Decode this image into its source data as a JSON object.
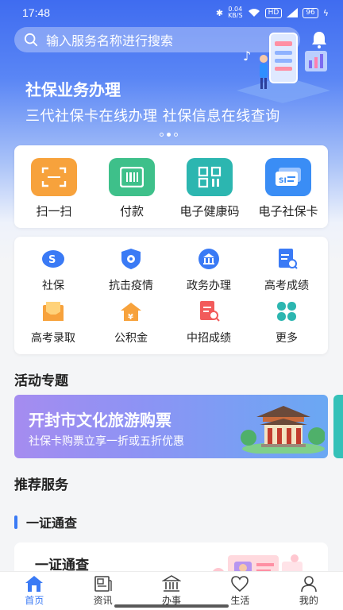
{
  "status_bar": {
    "time": "17:48",
    "net_speed_value": "0.04",
    "net_speed_unit": "KB/S",
    "hd_label": "HD",
    "battery": "96"
  },
  "search": {
    "placeholder": "输入服务名称进行搜索",
    "icon": "search-icon"
  },
  "banner": {
    "title": "社保业务办理",
    "subtitle": "三代社保卡在线办理  社保信息在线查询",
    "page_count": 3,
    "active_page": 2
  },
  "quick_actions": [
    {
      "label": "扫一扫",
      "icon": "scan-icon",
      "color": "#f7a23c"
    },
    {
      "label": "付款",
      "icon": "barcode-icon",
      "color": "#3ec08a"
    },
    {
      "label": "电子健康码",
      "icon": "qrcode-icon",
      "color": "#2cb6b0"
    },
    {
      "label": "电子社保卡",
      "icon": "social-security-card-icon",
      "color": "#3a8df5"
    }
  ],
  "services": [
    {
      "label": "社保",
      "icon": "social-security-icon"
    },
    {
      "label": "抗击疫情",
      "icon": "virus-shield-icon"
    },
    {
      "label": "政务办理",
      "icon": "government-icon"
    },
    {
      "label": "高考成绩",
      "icon": "exam-score-icon"
    },
    {
      "label": "高考录取",
      "icon": "admission-letter-icon"
    },
    {
      "label": "公积金",
      "icon": "housing-fund-icon"
    },
    {
      "label": "中招成绩",
      "icon": "zhongkao-score-icon"
    },
    {
      "label": "更多",
      "icon": "more-grid-icon"
    }
  ],
  "activity": {
    "section_title": "活动专题",
    "title": "开封市文化旅游购票",
    "subtitle": "社保卡购票立享一折或五折优惠"
  },
  "recommend": {
    "section_title": "推荐服务",
    "group_title": "一证通查",
    "card_title": "一证通查"
  },
  "tabs": [
    {
      "label": "首页",
      "icon": "home-icon",
      "active": true
    },
    {
      "label": "资讯",
      "icon": "news-icon",
      "active": false
    },
    {
      "label": "办事",
      "icon": "bank-building-icon",
      "active": false
    },
    {
      "label": "生活",
      "icon": "heart-icon",
      "active": false
    },
    {
      "label": "我的",
      "icon": "person-icon",
      "active": false
    }
  ]
}
